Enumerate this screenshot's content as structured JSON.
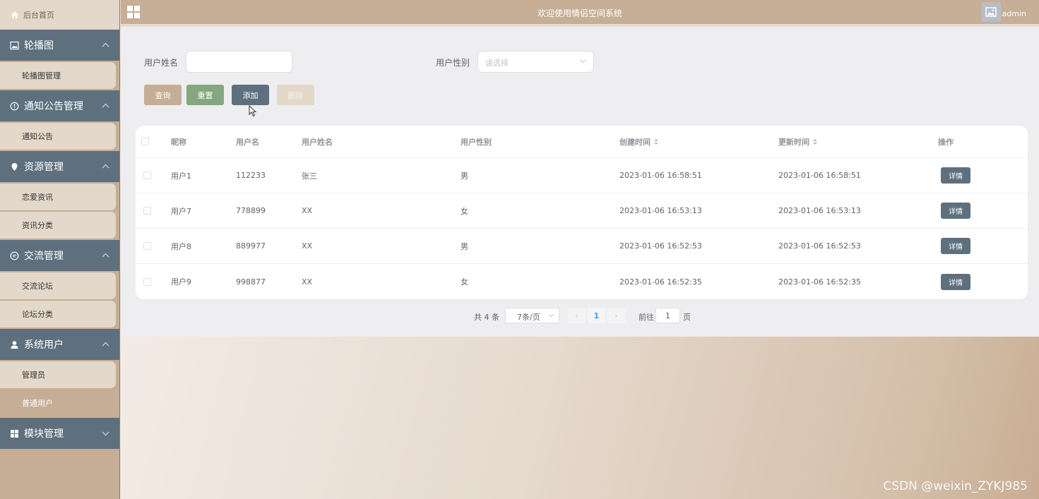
{
  "sidebar": {
    "home": "后台首页",
    "groups": [
      {
        "title": "轮播图",
        "icon": "image-icon",
        "items": [
          "轮播图管理"
        ]
      },
      {
        "title": "通知公告管理",
        "icon": "info-icon",
        "items": [
          "通知公告"
        ]
      },
      {
        "title": "资源管理",
        "icon": "location-icon",
        "items": [
          "恋爱资讯",
          "资讯分类"
        ]
      },
      {
        "title": "交流管理",
        "icon": "chat-icon",
        "items": [
          "交流论坛",
          "论坛分类"
        ]
      },
      {
        "title": "系统用户",
        "icon": "user-icon",
        "items": [
          "管理员",
          "普通用户"
        ],
        "active_item": "普通用户"
      },
      {
        "title": "模块管理",
        "icon": "module-icon",
        "items": [],
        "collapsed": true
      }
    ]
  },
  "header": {
    "title": "欢迎使用情侣空间系统",
    "user": "admin"
  },
  "search": {
    "name_label": "用户姓名",
    "name_value": "",
    "gender_label": "用户性别",
    "gender_placeholder": "请选择"
  },
  "buttons": {
    "query": "查询",
    "reset": "重置",
    "add": "添加",
    "delete": "删除"
  },
  "table": {
    "columns": [
      "昵称",
      "用户名",
      "用户姓名",
      "用户性别",
      "创建时间",
      "更新时间",
      "操作"
    ],
    "rows": [
      {
        "nickname": "用户1",
        "username": "112233",
        "name": "张三",
        "gender": "男",
        "created": "2023-01-06 16:58:51",
        "updated": "2023-01-06 16:58:51",
        "action": "详情"
      },
      {
        "nickname": "用户7",
        "username": "778899",
        "name": "XX",
        "gender": "女",
        "created": "2023-01-06 16:53:13",
        "updated": "2023-01-06 16:53:13",
        "action": "详情"
      },
      {
        "nickname": "用户8",
        "username": "889977",
        "name": "XX",
        "gender": "男",
        "created": "2023-01-06 16:52:53",
        "updated": "2023-01-06 16:52:53",
        "action": "详情"
      },
      {
        "nickname": "用户9",
        "username": "998877",
        "name": "XX",
        "gender": "女",
        "created": "2023-01-06 16:52:35",
        "updated": "2023-01-06 16:52:35",
        "action": "详情"
      }
    ]
  },
  "pagination": {
    "total": "共 4 条",
    "page_size": "7条/页",
    "current_page": "1",
    "goto_label": "前往",
    "goto_value": "1",
    "page_unit": "页"
  },
  "watermark": "CSDN @weixin_ZYKJ985"
}
